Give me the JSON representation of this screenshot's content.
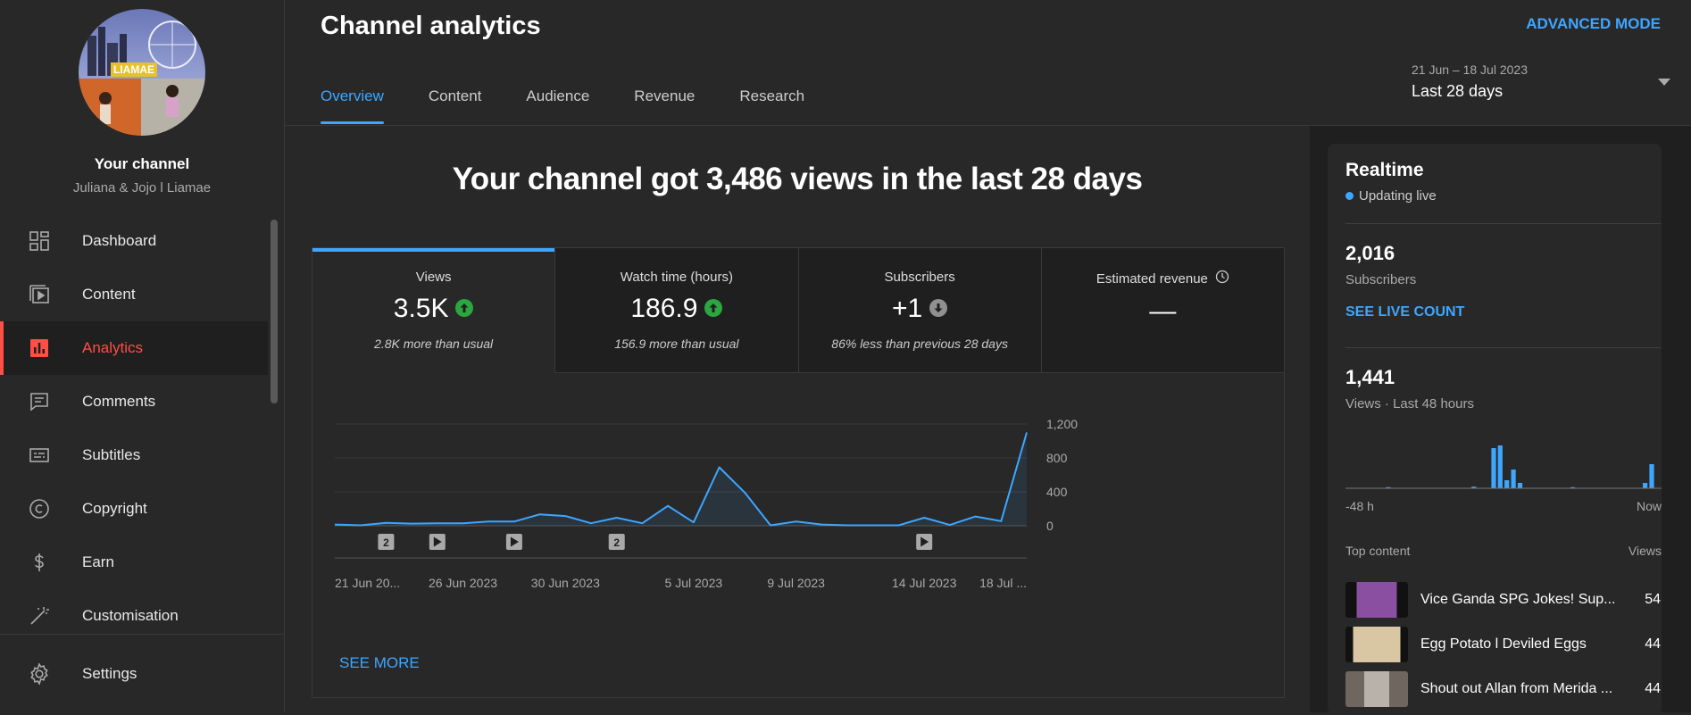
{
  "sidebar": {
    "your_channel": "Your channel",
    "channel_name": "Juliana & Jojo l Liamae",
    "avatar_text": "LIAMAE",
    "items": [
      {
        "label": "Dashboard",
        "icon": "dashboard-icon"
      },
      {
        "label": "Content",
        "icon": "content-icon"
      },
      {
        "label": "Analytics",
        "icon": "analytics-icon",
        "active": true
      },
      {
        "label": "Comments",
        "icon": "comments-icon"
      },
      {
        "label": "Subtitles",
        "icon": "subtitles-icon"
      },
      {
        "label": "Copyright",
        "icon": "copyright-icon"
      },
      {
        "label": "Earn",
        "icon": "earn-icon"
      },
      {
        "label": "Customisation",
        "icon": "customisation-icon"
      }
    ],
    "settings": "Settings"
  },
  "header": {
    "title": "Channel analytics",
    "advanced_mode": "ADVANCED MODE",
    "tabs": [
      "Overview",
      "Content",
      "Audience",
      "Revenue",
      "Research"
    ],
    "active_tab": "Overview",
    "date_range": "21 Jun – 18 Jul 2023",
    "period": "Last 28 days"
  },
  "main": {
    "headline": "Your channel got 3,486 views in the last 28 days",
    "metrics": [
      {
        "label": "Views",
        "value": "3.5K",
        "trend": "up",
        "sub": "2.8K more than usual"
      },
      {
        "label": "Watch time (hours)",
        "value": "186.9",
        "trend": "up",
        "sub": "156.9 more than usual"
      },
      {
        "label": "Subscribers",
        "value": "+1",
        "trend": "down",
        "sub": "86% less than previous 28 days"
      },
      {
        "label": "Estimated revenue",
        "value": "—",
        "trend": "none",
        "sub": ""
      }
    ],
    "see_more": "SEE MORE"
  },
  "chart_data": {
    "type": "area",
    "title": "",
    "x_tick_labels": [
      "21 Jun 20...",
      "26 Jun 2023",
      "30 Jun 2023",
      "5 Jul 2023",
      "9 Jul 2023",
      "14 Jul 2023",
      "18 Jul ..."
    ],
    "x": [
      "21 Jun",
      "22 Jun",
      "23 Jun",
      "24 Jun",
      "25 Jun",
      "26 Jun",
      "27 Jun",
      "28 Jun",
      "29 Jun",
      "30 Jun",
      "1 Jul",
      "2 Jul",
      "3 Jul",
      "4 Jul",
      "5 Jul",
      "6 Jul",
      "7 Jul",
      "8 Jul",
      "9 Jul",
      "10 Jul",
      "11 Jul",
      "12 Jul",
      "13 Jul",
      "14 Jul",
      "15 Jul",
      "16 Jul",
      "17 Jul",
      "18 Jul"
    ],
    "series": [
      {
        "values": [
          15,
          5,
          35,
          25,
          30,
          30,
          50,
          50,
          135,
          115,
          30,
          95,
          30,
          235,
          40,
          690,
          390,
          5,
          50,
          15,
          5,
          5,
          5,
          95,
          10,
          110,
          55,
          1100
        ]
      }
    ],
    "ylim": [
      0,
      1200
    ],
    "y_ticks": [
      "1,200",
      "800",
      "400",
      "0"
    ],
    "y_tick_values": [
      1200,
      800,
      400,
      0
    ],
    "markers": [
      {
        "day_index": 2,
        "kind": "number",
        "label": "2"
      },
      {
        "day_index": 4,
        "kind": "play",
        "label": ""
      },
      {
        "day_index": 7,
        "kind": "play",
        "label": ""
      },
      {
        "day_index": 11,
        "kind": "number",
        "label": "2"
      },
      {
        "day_index": 23,
        "kind": "play",
        "label": ""
      }
    ],
    "color": "#3ea6ff"
  },
  "realtime": {
    "title": "Realtime",
    "updating": "Updating live",
    "subscribers_value": "2,016",
    "subscribers_label": "Subscribers",
    "see_live_count": "SEE LIVE COUNT",
    "views_value": "1,441",
    "views_label": "Views · Last 48 hours",
    "axis_left": "-48 h",
    "axis_right": "Now",
    "hourly_views": [
      0,
      0,
      0,
      0,
      0,
      0,
      2,
      0,
      0,
      0,
      0,
      0,
      0,
      0,
      0,
      0,
      0,
      0,
      0,
      3,
      0,
      0,
      75,
      80,
      15,
      35,
      10,
      0,
      0,
      0,
      0,
      0,
      0,
      0,
      2,
      0,
      0,
      0,
      0,
      0,
      0,
      0,
      0,
      0,
      0,
      10,
      45,
      0
    ],
    "top_content_label": "Top content",
    "top_content_views_label": "Views",
    "top_content": [
      {
        "title": "Vice Ganda SPG Jokes! Sup...",
        "views": "54",
        "thumb": "#8a4fa0"
      },
      {
        "title": "Egg Potato l Deviled Eggs",
        "views": "44",
        "thumb": "#c9b08a"
      },
      {
        "title": "Shout out Allan from Merida ...",
        "views": "44",
        "thumb": "#9a8b80"
      }
    ]
  }
}
